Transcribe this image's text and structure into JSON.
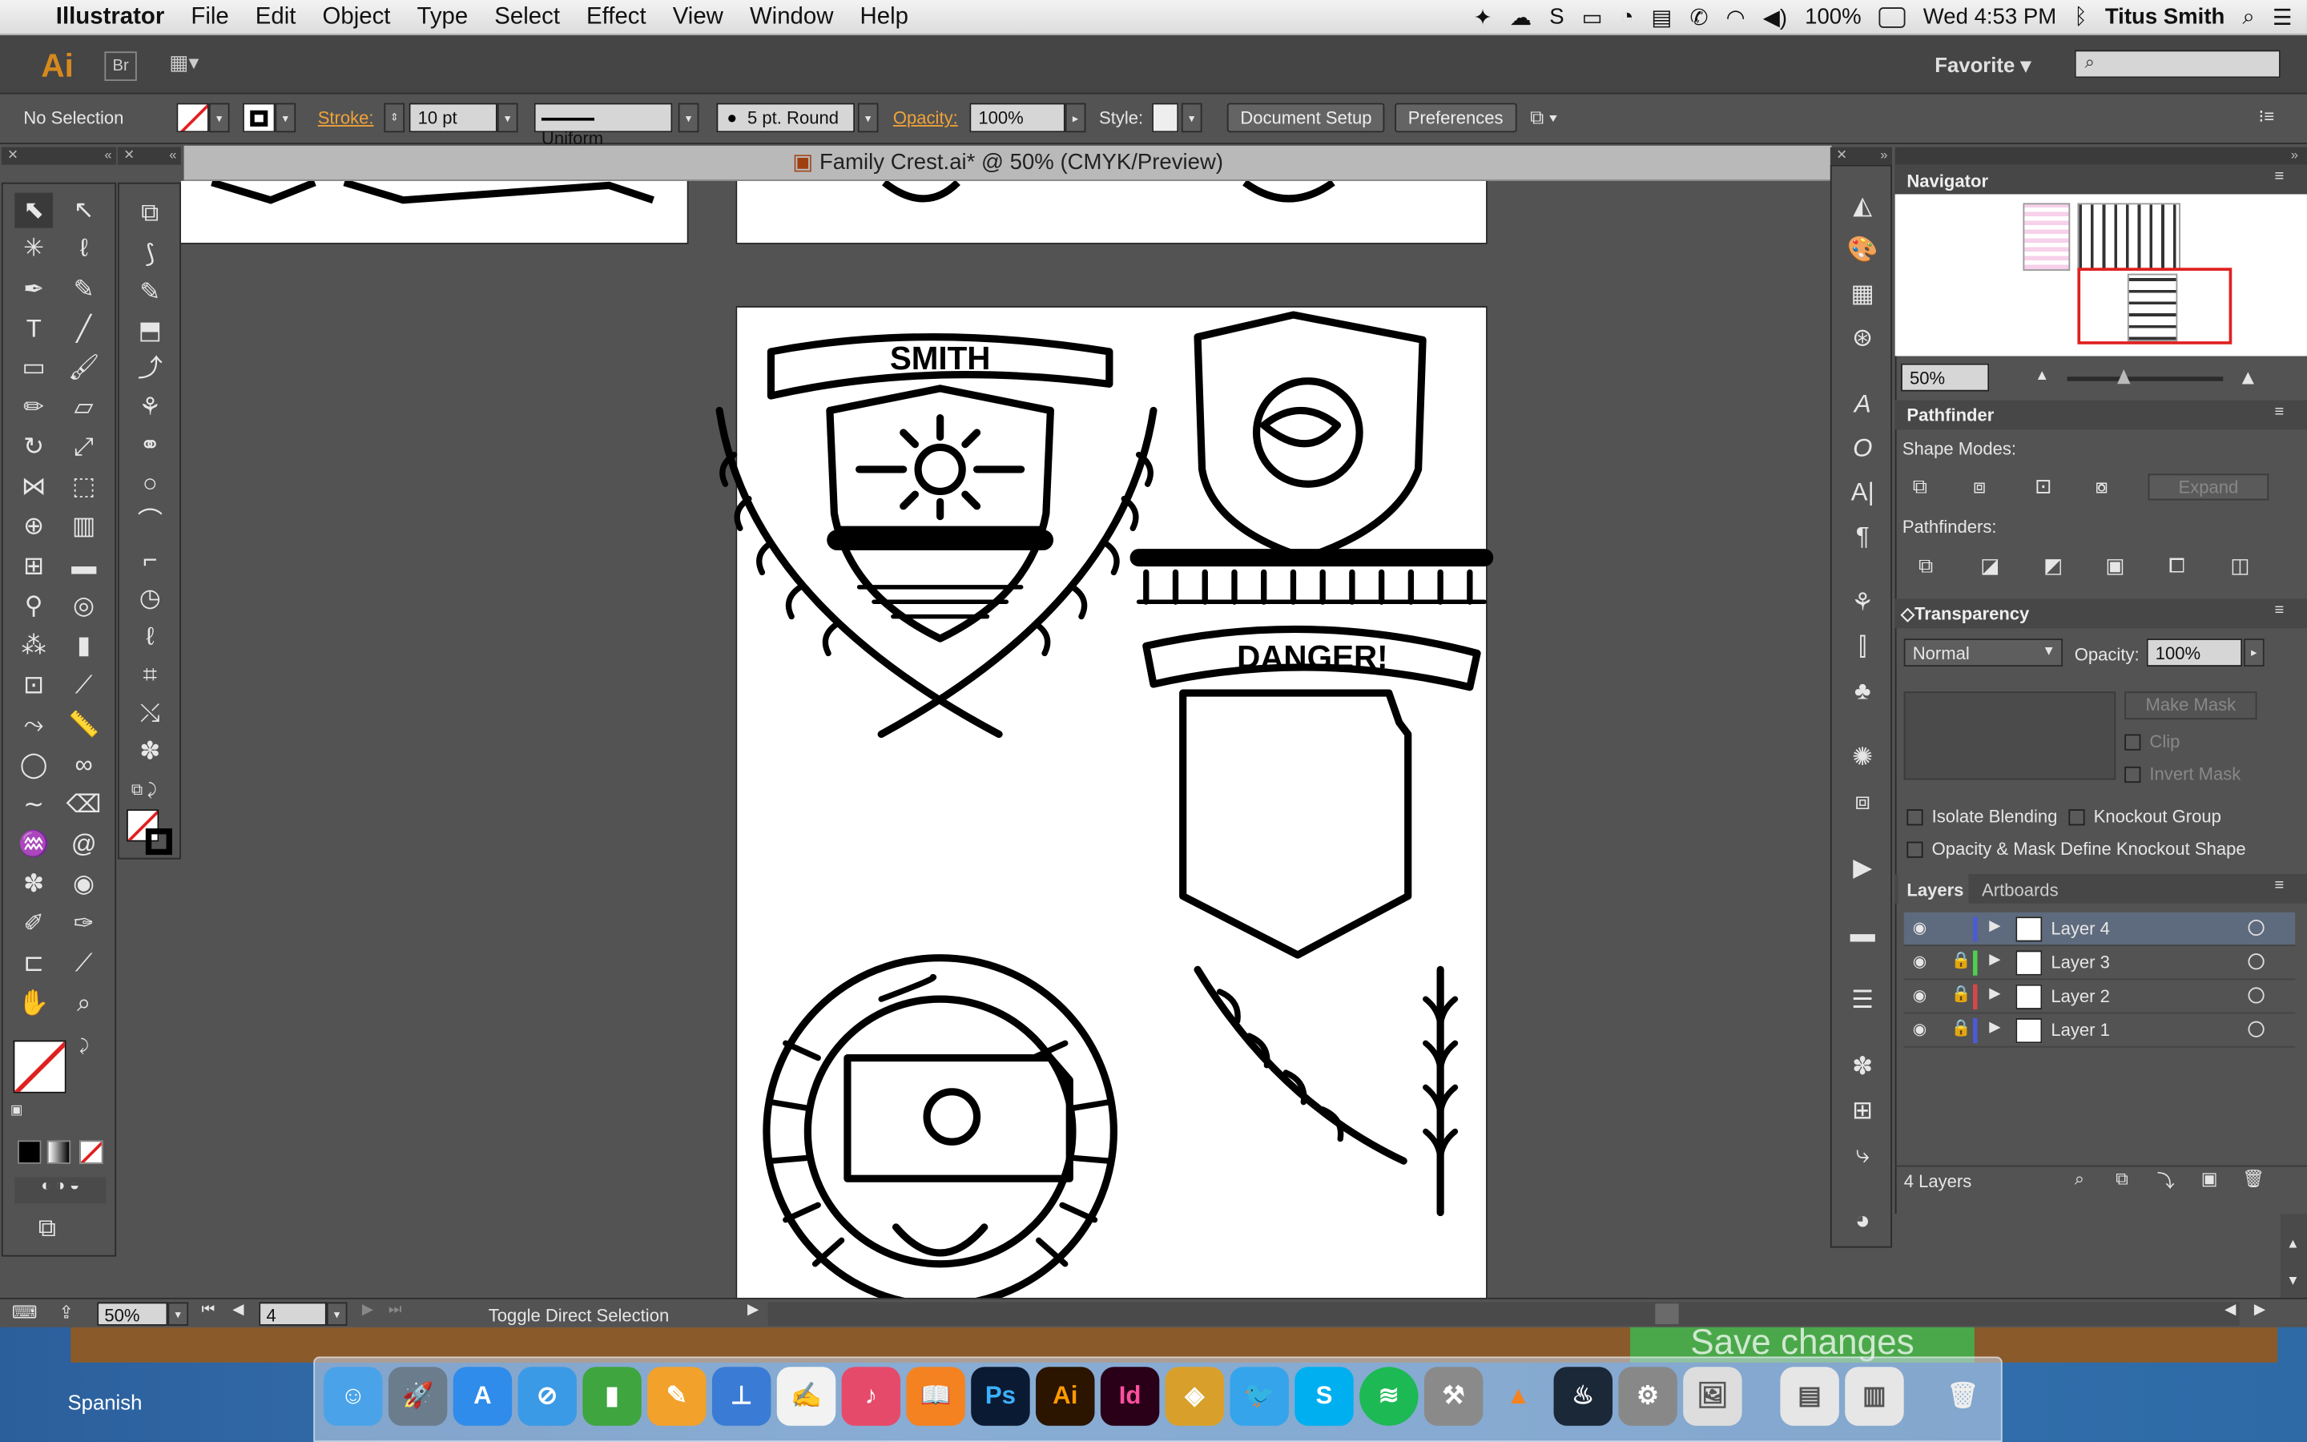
{
  "menubar": {
    "apple": "",
    "app_name": "Illustrator",
    "items": [
      "File",
      "Edit",
      "Object",
      "Type",
      "Select",
      "Effect",
      "View",
      "Window",
      "Help"
    ],
    "battery": "100%",
    "clock": "Wed 4:53 PM",
    "user": "Titus Smith"
  },
  "appbar": {
    "logo": "Ai",
    "bridge": "Br",
    "workspace": "Favorite"
  },
  "control": {
    "selection": "No Selection",
    "stroke_label": "Stroke:",
    "stroke_weight": "10 pt",
    "profile": "Uniform",
    "brush": "5 pt. Round",
    "opacity_label": "Opacity:",
    "opacity": "100%",
    "style_label": "Style:",
    "doc_setup": "Document Setup",
    "preferences": "Preferences"
  },
  "document": {
    "tab_title": "Family Crest.ai* @ 50% (CMYK/Preview)"
  },
  "artwork": {
    "smith": "SMITH",
    "danger": "DANGER!"
  },
  "navigator": {
    "title": "Navigator",
    "zoom": "50%"
  },
  "pathfinder": {
    "title": "Pathfinder",
    "shape_modes": "Shape Modes:",
    "pathfinders": "Pathfinders:",
    "expand": "Expand"
  },
  "transparency": {
    "title": "Transparency",
    "mode": "Normal",
    "opacity_label": "Opacity:",
    "opacity": "100%",
    "make_mask": "Make Mask",
    "clip": "Clip",
    "invert": "Invert Mask",
    "isolate": "Isolate Blending",
    "knockout": "Knockout Group",
    "define": "Opacity & Mask Define Knockout Shape"
  },
  "layers": {
    "tab_layers": "Layers",
    "tab_artboards": "Artboards",
    "items": [
      {
        "name": "Layer 4",
        "color": "#4b5bd6"
      },
      {
        "name": "Layer 3",
        "color": "#4fcf4f"
      },
      {
        "name": "Layer 2",
        "color": "#d64848"
      },
      {
        "name": "Layer 1",
        "color": "#4b5bd6"
      }
    ],
    "count": "4 Layers"
  },
  "status": {
    "zoom": "50%",
    "artboard": "4",
    "tool": "Toggle Direct Selection"
  },
  "desktop": {
    "save_changes": "Save changes",
    "input_source": "Spanish"
  },
  "dock_apps": [
    "Finder",
    "Launchpad",
    "App Store",
    "Safari",
    "Numbers",
    "Pages",
    "Keynote",
    "TextEdit",
    "iTunes",
    "iBooks",
    "Ps",
    "Ai",
    "Id",
    "Sketch",
    "Twitter",
    "Skype",
    "Spotify",
    "Utility",
    "VLC",
    "Steam",
    "System Preferences",
    "Preview",
    "Downloads",
    "Documents",
    "Trash"
  ]
}
